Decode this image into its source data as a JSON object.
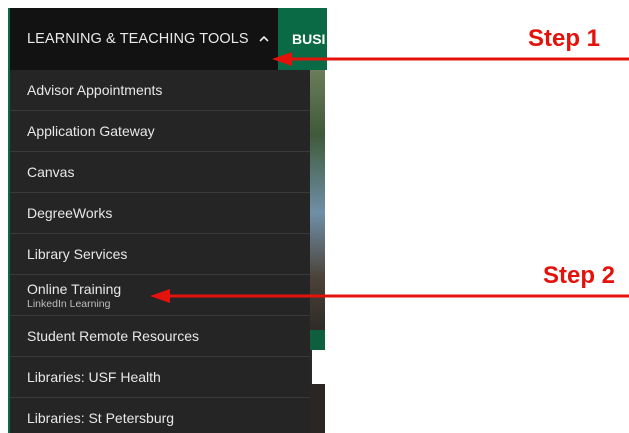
{
  "nav": {
    "menu_title": "LEARNING & TEACHING TOOLS",
    "next_item": "BUSI",
    "chevron_icon": "chevron-up-icon"
  },
  "dropdown": {
    "items": [
      {
        "label": "Advisor Appointments",
        "sub": ""
      },
      {
        "label": "Application Gateway",
        "sub": ""
      },
      {
        "label": "Canvas",
        "sub": ""
      },
      {
        "label": "DegreeWorks",
        "sub": ""
      },
      {
        "label": "Library Services",
        "sub": ""
      },
      {
        "label": "Online Training",
        "sub": "LinkedIn Learning"
      },
      {
        "label": "Student Remote Resources",
        "sub": ""
      },
      {
        "label": "Libraries: USF Health",
        "sub": ""
      },
      {
        "label": "Libraries: St Petersburg",
        "sub": ""
      }
    ]
  },
  "annotations": {
    "step1": "Step 1",
    "step2": "Step 2",
    "arrow_color": "#e3120b"
  },
  "colors": {
    "nav_bg": "#121212",
    "dropdown_bg": "#252525",
    "accent_green": "#0a6a45"
  }
}
